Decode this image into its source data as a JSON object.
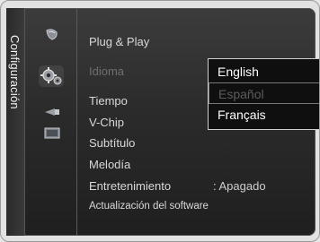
{
  "sidebar": {
    "title": "Configuración"
  },
  "icons": [
    "picture-icon",
    "setup-icon",
    "input-icon",
    "application-icon"
  ],
  "menu": {
    "items": [
      {
        "label": "Plug & Play",
        "value": ""
      },
      {
        "label": "Idioma",
        "value": ":"
      },
      {
        "label": "Tiempo",
        "value": ""
      },
      {
        "label": "V-Chip",
        "value": ""
      },
      {
        "label": "Subtítulo",
        "value": ""
      },
      {
        "label": "Melodía",
        "value": ""
      },
      {
        "label": "Entretenimiento",
        "value": ": Apagado"
      },
      {
        "label": "Actualización del software",
        "value": ""
      }
    ]
  },
  "language_dropdown": {
    "options": [
      {
        "label": "English",
        "disabled": false
      },
      {
        "label": "Español",
        "disabled": true
      },
      {
        "label": "Français",
        "disabled": false
      }
    ]
  }
}
